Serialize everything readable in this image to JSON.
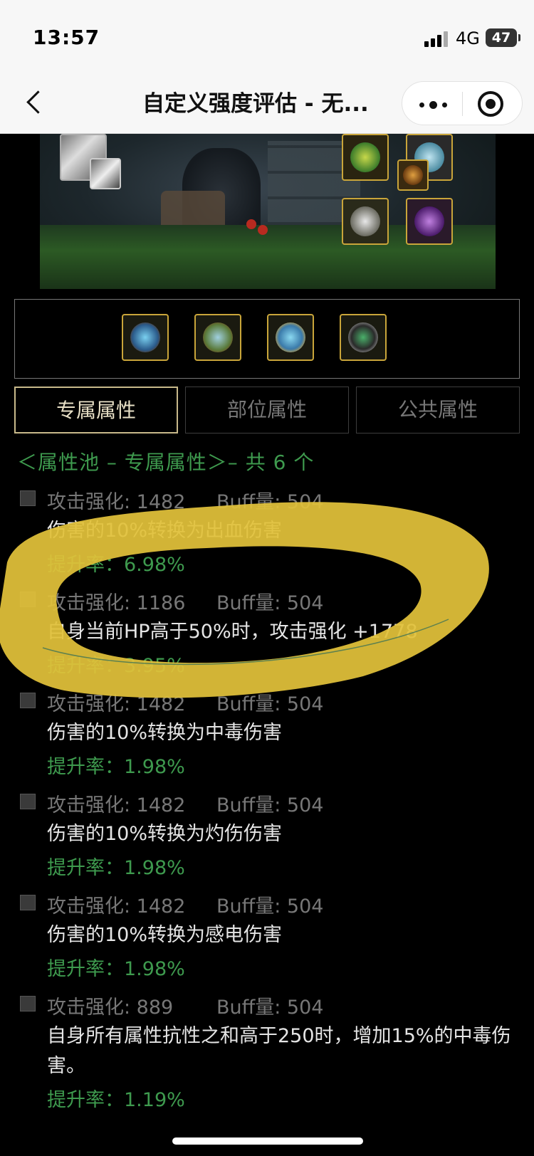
{
  "status_bar": {
    "time": "13:57",
    "network": "4G",
    "battery": "47"
  },
  "nav": {
    "title": "自定义强度评估 - 无..."
  },
  "tabs": [
    {
      "label": "专属属性",
      "active": true
    },
    {
      "label": "部位属性",
      "active": false
    },
    {
      "label": "公共属性",
      "active": false
    }
  ],
  "pool": {
    "title": "＜属性池 – 专属属性＞– 共 6 个"
  },
  "entries": [
    {
      "stat": "攻击强化: 1482",
      "buff": "Buff量: 504",
      "desc": "伤害的10%转换为出血伤害",
      "rate": "提升率：6.98%"
    },
    {
      "stat": "攻击强化: 1186",
      "buff": "Buff量: 504",
      "desc": "自身当前HP高于50%时，攻击强化 +1778",
      "rate": "提升率：3.95%"
    },
    {
      "stat": "攻击强化: 1482",
      "buff": "Buff量: 504",
      "desc": "伤害的10%转换为中毒伤害",
      "rate": "提升率：1.98%"
    },
    {
      "stat": "攻击强化: 1482",
      "buff": "Buff量: 504",
      "desc": "伤害的10%转换为灼伤伤害",
      "rate": "提升率：1.98%"
    },
    {
      "stat": "攻击强化: 1482",
      "buff": "Buff量: 504",
      "desc": "伤害的10%转换为感电伤害",
      "rate": "提升率：1.98%"
    },
    {
      "stat": "攻击强化: 889",
      "buff": "Buff量: 504",
      "desc": "自身所有属性抗性之和高于250时，增加15%的中毒伤害。",
      "rate": "提升率：1.19%"
    }
  ],
  "colors": {
    "accent_green": "#3e9a4e",
    "gold_border": "#c9a53a",
    "highlight_yellow": "#e2c23a"
  }
}
